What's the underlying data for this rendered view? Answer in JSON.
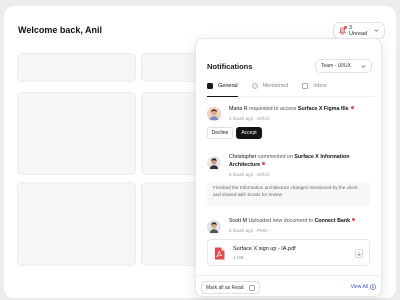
{
  "header": {
    "welcome": "Welcome back, Anil",
    "unread_label": "3 Unread"
  },
  "panel": {
    "title": "Notifications",
    "team_select": "Team - UI/UX",
    "tabs": [
      {
        "label": "General",
        "icon": "inbox-filled-icon"
      },
      {
        "label": "Mentioned",
        "icon": "at-icon"
      },
      {
        "label": "Inbox",
        "icon": "inbox-icon"
      }
    ],
    "notifications": [
      {
        "name": "Maria R",
        "action": "requested to access",
        "target": "Surface X Figma file",
        "meta": "2 hours ago . UI/UX",
        "decline": "Decline",
        "accept": "Accept"
      },
      {
        "name": "Christopher",
        "action": "commented on",
        "target": "Surface X  Information Architecture",
        "meta": "6 hours ago . UI/UX",
        "comment": "Finished the Information  architecture changes mentioned by the client and shared with Scotts for review"
      },
      {
        "name": "Scott M",
        "action": "Uploaded new document to",
        "target": "Connect Bank",
        "meta": "8 hours ago . PMO",
        "file_name": "Surface X  sign up - IA.pdf",
        "file_size": "4 MB"
      }
    ],
    "mark_all_read": "Mark  all as Read",
    "view_all": "View All"
  },
  "colors": {
    "accent": "#3c54d6",
    "unread_dot": "#e5484d",
    "accept_bg": "#141414"
  }
}
